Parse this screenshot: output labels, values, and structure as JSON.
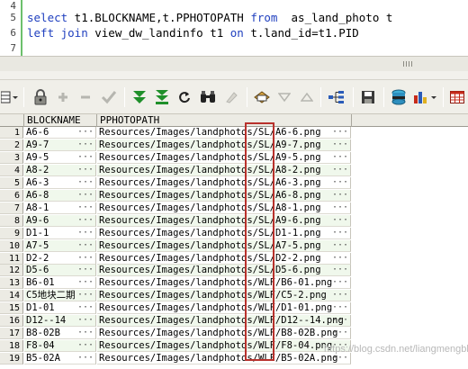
{
  "editor": {
    "lines": [
      {
        "num": "4",
        "kw1": "",
        "text1": "",
        "kw2": "",
        "text2": "",
        "kw3": "",
        "text3": ""
      },
      {
        "num": "5",
        "kw1": "select",
        "text1": " t1.BLOCKNAME,t.PPHOTOPATH ",
        "kw2": "from",
        "text2": "  as_land_photo t",
        "kw3": "",
        "text3": ""
      },
      {
        "num": "6",
        "kw1": "left join",
        "text1": " view_dw_landinfo t1 ",
        "kw2": "on",
        "text2": " t.land_id=t1.PID",
        "kw3": "",
        "text3": ""
      },
      {
        "num": "7",
        "kw1": "",
        "text1": "",
        "kw2": "",
        "text2": "",
        "kw3": "",
        "text3": ""
      }
    ]
  },
  "toolbar": {
    "icons": [
      "grid-mode-icon",
      "lock-icon",
      "add-record-icon",
      "delete-record-icon",
      "post-changes-icon",
      "fetch-next-icon",
      "fetch-last-icon",
      "refresh-icon",
      "find-icon",
      "clear-icon",
      "query-by-example-icon",
      "filter-down-icon",
      "filter-up-icon",
      "tree-view-icon",
      "save-icon",
      "export-icon",
      "chart-icon",
      "grid-icon"
    ],
    "colors": {
      "green": "#1f8f2a",
      "blue": "#2a5bb8",
      "red": "#c62a1a",
      "gray": "#b6b6b0"
    }
  },
  "grid": {
    "columns": [
      "BLOCKNAME",
      "PPHOTOPATH"
    ],
    "rows": [
      {
        "n": "1",
        "block": "A6-6",
        "path": "Resources/Images/landphotos/SL/A6-6.png"
      },
      {
        "n": "2",
        "block": "A9-7",
        "path": "Resources/Images/landphotos/SL/A9-7.png"
      },
      {
        "n": "3",
        "block": "A9-5",
        "path": "Resources/Images/landphotos/SL/A9-5.png"
      },
      {
        "n": "4",
        "block": "A8-2",
        "path": "Resources/Images/landphotos/SL/A8-2.png"
      },
      {
        "n": "5",
        "block": "A6-3",
        "path": "Resources/Images/landphotos/SL/A6-3.png"
      },
      {
        "n": "6",
        "block": "A6-8",
        "path": "Resources/Images/landphotos/SL/A6-8.png"
      },
      {
        "n": "7",
        "block": "A8-1",
        "path": "Resources/Images/landphotos/SL/A8-1.png"
      },
      {
        "n": "8",
        "block": "A9-6",
        "path": "Resources/Images/landphotos/SL/A9-6.png"
      },
      {
        "n": "9",
        "block": "D1-1",
        "path": "Resources/Images/landphotos/SL/D1-1.png"
      },
      {
        "n": "10",
        "block": "A7-5",
        "path": "Resources/Images/landphotos/SL/A7-5.png"
      },
      {
        "n": "11",
        "block": "D2-2",
        "path": "Resources/Images/landphotos/SL/D2-2.png"
      },
      {
        "n": "12",
        "block": "D5-6",
        "path": "Resources/Images/landphotos/SL/D5-6.png"
      },
      {
        "n": "13",
        "block": "B6-01",
        "path": "Resources/Images/landphotos/WLF/B6-01.png"
      },
      {
        "n": "14",
        "block": "C5地块二期",
        "path": "Resources/Images/landphotos/WLF/C5-2.png"
      },
      {
        "n": "15",
        "block": "D1-01",
        "path": "Resources/Images/landphotos/WLF/D1-01.png"
      },
      {
        "n": "16",
        "block": "D12--14",
        "path": "Resources/Images/landphotos/WLF/D12--14.png"
      },
      {
        "n": "17",
        "block": "B8-02B",
        "path": "Resources/Images/landphotos/WLF/B8-02B.png"
      },
      {
        "n": "18",
        "block": "F8-04",
        "path": "Resources/Images/landphotos/WLF/F8-04.png"
      },
      {
        "n": "19",
        "block": "B5-02A",
        "path": "Resources/Images/landphotos/WLF/B5-02A.png"
      }
    ],
    "cell_button": "···",
    "highlight_color": "#b8312c",
    "alt_row_color": "#f0f8ec"
  },
  "watermark": "https://blog.csdn.net/liangmengbk"
}
